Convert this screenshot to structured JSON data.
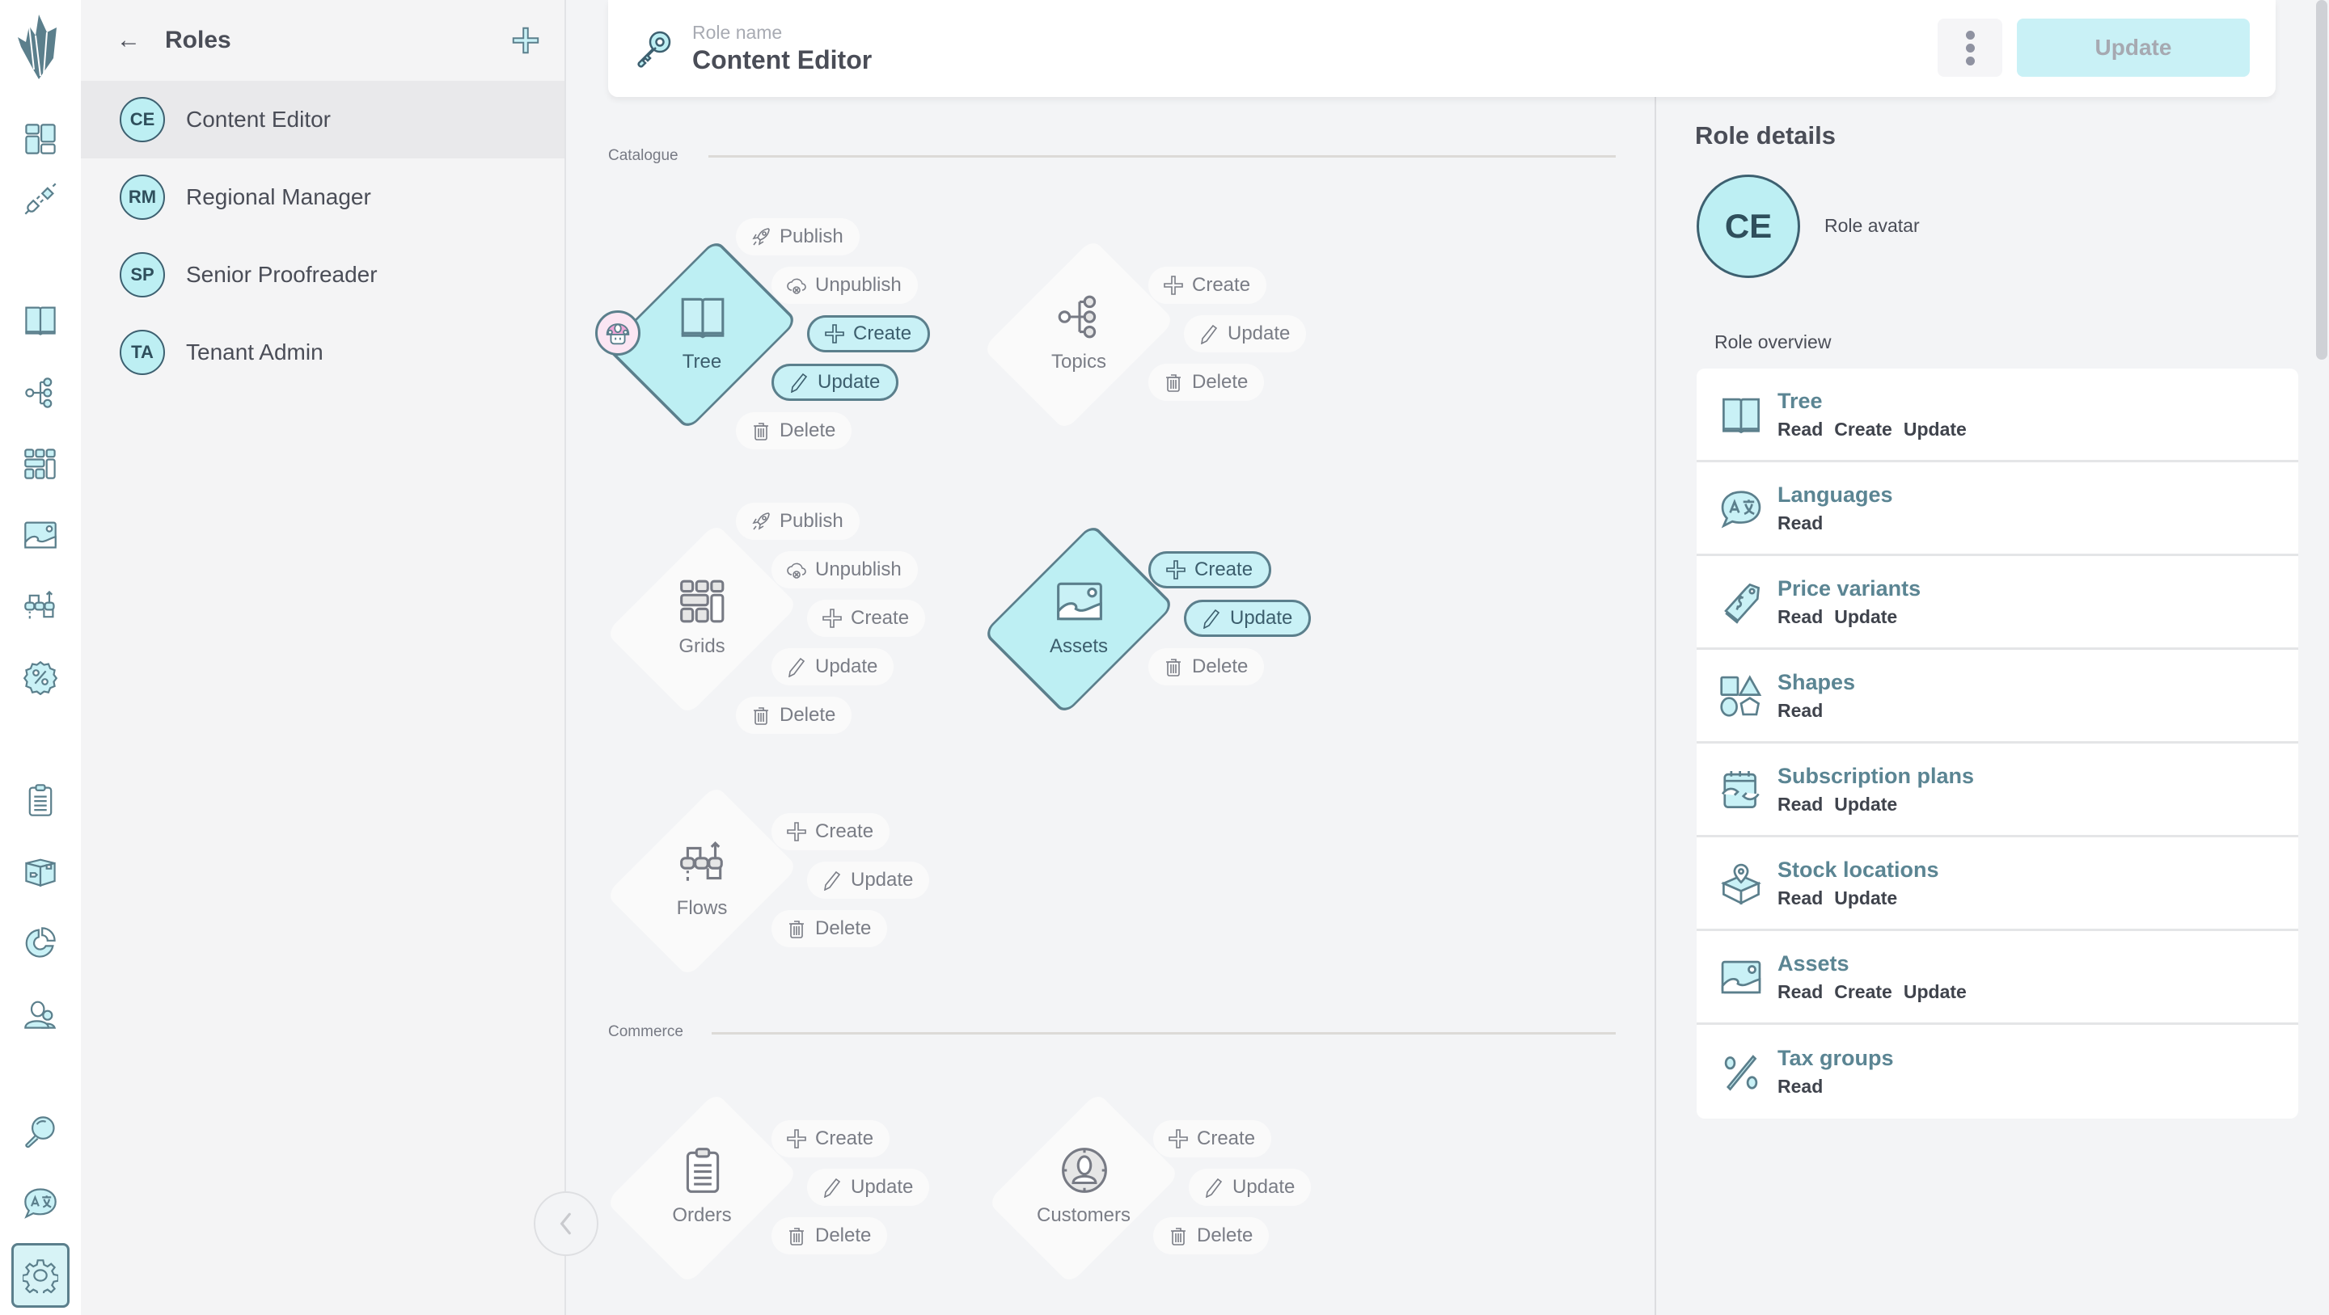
{
  "nav": {
    "items": [
      {
        "icon": "dashboard-icon"
      },
      {
        "icon": "plug-icon"
      },
      {
        "icon": "book-icon"
      },
      {
        "icon": "topics-icon"
      },
      {
        "icon": "grid-icon"
      },
      {
        "icon": "image-icon"
      },
      {
        "icon": "flows-icon"
      },
      {
        "icon": "discount-icon"
      },
      {
        "icon": "clipboard-icon"
      },
      {
        "icon": "box-icon"
      },
      {
        "icon": "pie-chart-icon"
      },
      {
        "icon": "users-icon"
      },
      {
        "icon": "search-icon"
      },
      {
        "icon": "translate-icon"
      },
      {
        "icon": "settings-icon"
      }
    ],
    "active": "settings-icon"
  },
  "roles_panel": {
    "title": "Roles",
    "back_icon": "←",
    "roles": [
      {
        "initials": "CE",
        "name": "Content Editor",
        "selected": true
      },
      {
        "initials": "RM",
        "name": "Regional Manager",
        "selected": false
      },
      {
        "initials": "SP",
        "name": "Senior Proofreader",
        "selected": false
      },
      {
        "initials": "TA",
        "name": "Tenant Admin",
        "selected": false
      }
    ]
  },
  "header": {
    "field_label": "Role name",
    "field_value": "Content Editor",
    "update_label": "Update"
  },
  "sections": [
    {
      "label": "Catalogue",
      "nodes": [
        {
          "name": "Tree",
          "enabled": true,
          "permissions": [
            {
              "label": "Publish",
              "icon": "rocket-icon",
              "enabled": false
            },
            {
              "label": "Unpublish",
              "icon": "cloud-off-icon",
              "enabled": false
            },
            {
              "label": "Create",
              "icon": "plus-icon",
              "enabled": true
            },
            {
              "label": "Update",
              "icon": "pencil-icon",
              "enabled": true
            },
            {
              "label": "Delete",
              "icon": "trash-icon",
              "enabled": false
            }
          ]
        },
        {
          "name": "Topics",
          "enabled": false,
          "permissions": [
            {
              "label": "Create",
              "icon": "plus-icon",
              "enabled": false
            },
            {
              "label": "Update",
              "icon": "pencil-icon",
              "enabled": false
            },
            {
              "label": "Delete",
              "icon": "trash-icon",
              "enabled": false
            }
          ]
        },
        {
          "name": "Grids",
          "enabled": false,
          "permissions": [
            {
              "label": "Publish",
              "icon": "rocket-icon",
              "enabled": false
            },
            {
              "label": "Unpublish",
              "icon": "cloud-off-icon",
              "enabled": false
            },
            {
              "label": "Create",
              "icon": "plus-icon",
              "enabled": false
            },
            {
              "label": "Update",
              "icon": "pencil-icon",
              "enabled": false
            },
            {
              "label": "Delete",
              "icon": "trash-icon",
              "enabled": false
            }
          ]
        },
        {
          "name": "Assets",
          "enabled": true,
          "permissions": [
            {
              "label": "Create",
              "icon": "plus-icon",
              "enabled": true
            },
            {
              "label": "Update",
              "icon": "pencil-icon",
              "enabled": true
            },
            {
              "label": "Delete",
              "icon": "trash-icon",
              "enabled": false
            }
          ]
        },
        {
          "name": "Flows",
          "enabled": false,
          "permissions": [
            {
              "label": "Create",
              "icon": "plus-icon",
              "enabled": false
            },
            {
              "label": "Update",
              "icon": "pencil-icon",
              "enabled": false
            },
            {
              "label": "Delete",
              "icon": "trash-icon",
              "enabled": false
            }
          ]
        }
      ]
    },
    {
      "label": "Commerce",
      "nodes": [
        {
          "name": "Orders",
          "enabled": false,
          "permissions": [
            {
              "label": "Create",
              "icon": "plus-icon",
              "enabled": false
            },
            {
              "label": "Update",
              "icon": "pencil-icon",
              "enabled": false
            },
            {
              "label": "Delete",
              "icon": "trash-icon",
              "enabled": false
            }
          ]
        },
        {
          "name": "Customers",
          "enabled": false,
          "permissions": [
            {
              "label": "Create",
              "icon": "plus-icon",
              "enabled": false
            },
            {
              "label": "Update",
              "icon": "pencil-icon",
              "enabled": false
            },
            {
              "label": "Delete",
              "icon": "trash-icon",
              "enabled": false
            }
          ]
        }
      ]
    }
  ],
  "details": {
    "title": "Role details",
    "avatar_initials": "CE",
    "avatar_label": "Role avatar",
    "overview_title": "Role overview",
    "overview": [
      {
        "name": "Tree",
        "icon": "book-icon",
        "perms": [
          "Read",
          "Create",
          "Update"
        ]
      },
      {
        "name": "Languages",
        "icon": "translate-icon",
        "perms": [
          "Read"
        ]
      },
      {
        "name": "Price variants",
        "icon": "price-tag-icon",
        "perms": [
          "Read",
          "Update"
        ]
      },
      {
        "name": "Shapes",
        "icon": "shapes-icon",
        "perms": [
          "Read"
        ]
      },
      {
        "name": "Subscription plans",
        "icon": "subscription-icon",
        "perms": [
          "Read",
          "Update"
        ]
      },
      {
        "name": "Stock locations",
        "icon": "stock-location-icon",
        "perms": [
          "Read",
          "Update"
        ]
      },
      {
        "name": "Assets",
        "icon": "image-icon",
        "perms": [
          "Read",
          "Create",
          "Update"
        ]
      },
      {
        "name": "Tax groups",
        "icon": "percent-icon",
        "perms": [
          "Read"
        ]
      }
    ]
  },
  "colors": {
    "accent": "#bdeff3",
    "accent_border": "#5b7f8c",
    "text": "#4a4d57",
    "muted": "#7a7d86",
    "background": "#f3f4f6"
  }
}
